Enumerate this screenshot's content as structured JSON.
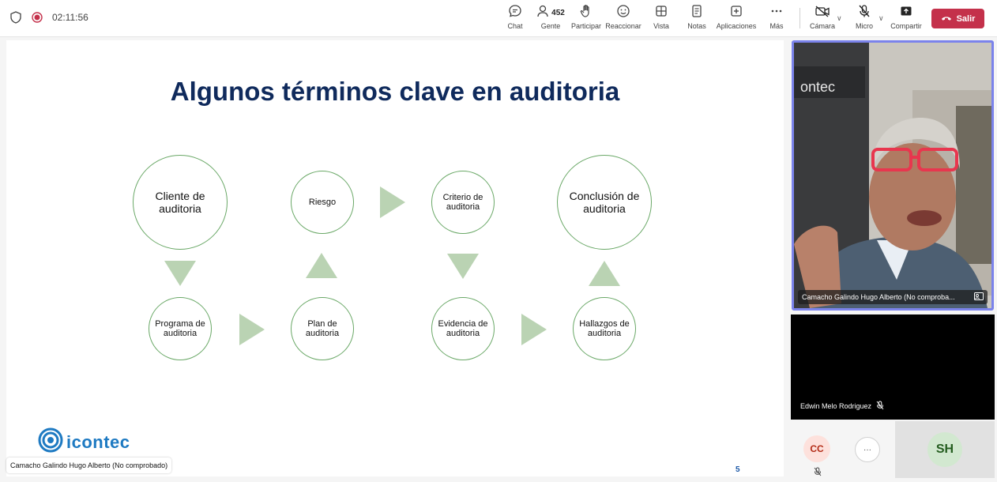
{
  "meeting": {
    "timer": "02:11:56"
  },
  "toolbar": {
    "chat_label": "Chat",
    "people_label": "Gente",
    "people_count": "452",
    "raise_label": "Participar",
    "react_label": "Reaccionar",
    "view_label": "Vista",
    "notes_label": "Notas",
    "apps_label": "Aplicaciones",
    "more_label": "Más",
    "camera_label": "Cámara",
    "mic_label": "Micro",
    "share_label": "Compartir",
    "leave_label": "Salir"
  },
  "slide": {
    "title": "Algunos términos clave en auditoria",
    "nodes": {
      "cliente": "Cliente de auditoria",
      "riesgo": "Riesgo",
      "criterio": "Criterio de auditoria",
      "conclusion": "Conclusión de auditoria",
      "programa": "Programa de auditoria",
      "plan": "Plan de auditoria",
      "evidencia": "Evidencia de auditoria",
      "hallazgos": "Hallazgos de auditoria"
    },
    "logo_text": "icontec",
    "page_number": "5",
    "presenter_tag": "Camacho Galindo Hugo Alberto (No comprobado)"
  },
  "participants": {
    "main_name": "Camacho Galindo Hugo Alberto (No comproba...",
    "second_name": "Edwin Melo Rodriguez",
    "cc_initials": "CC",
    "more_label": "···",
    "sh_initials": "SH"
  },
  "colors": {
    "title": "#0f2a5c",
    "node_border": "#6aa867",
    "arrow": "#bad3b3",
    "leave": "#c4314b",
    "active_speaker": "#7b83eb"
  }
}
